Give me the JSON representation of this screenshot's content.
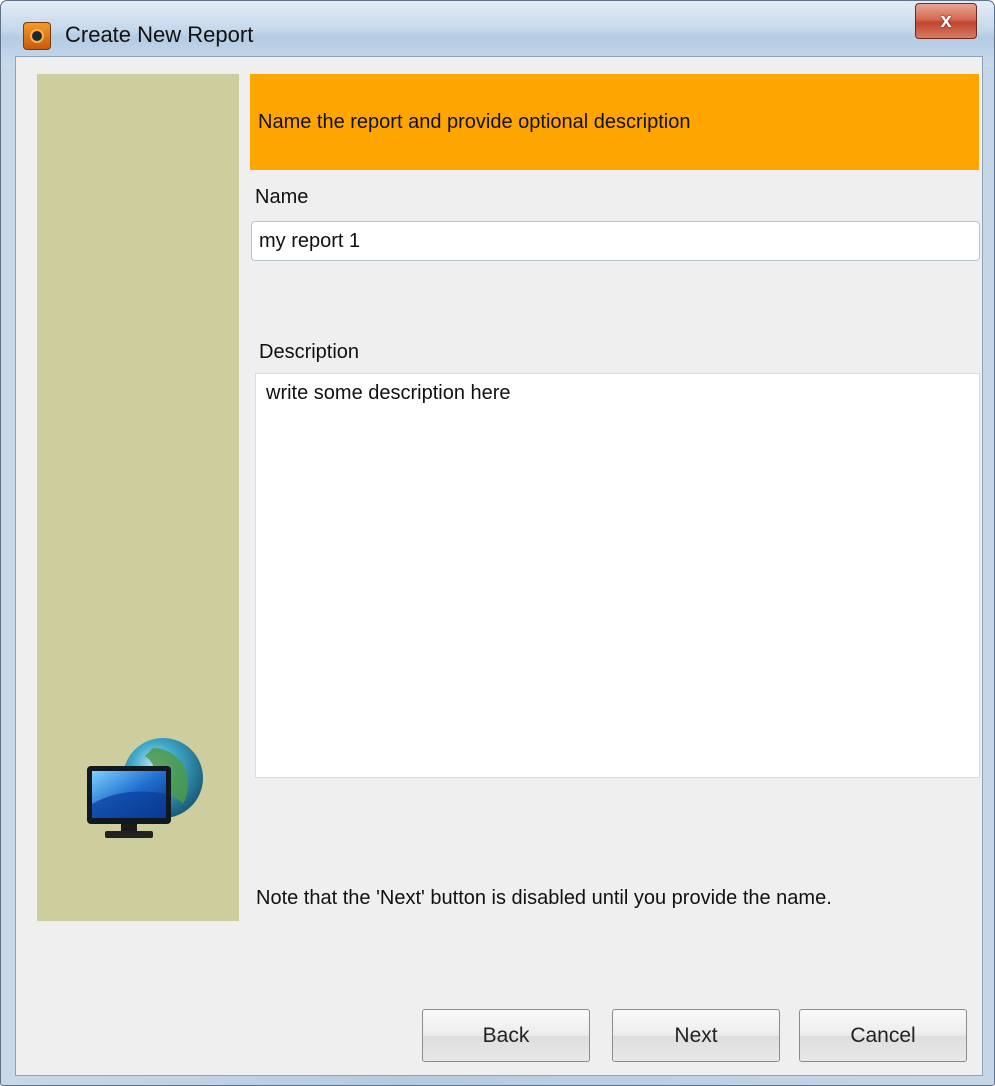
{
  "window": {
    "title": "Create New Report",
    "close_label": "x"
  },
  "icons": {
    "app": "report-app-icon",
    "close": "close-icon",
    "side": "monitor-globe-icon"
  },
  "header": {
    "instruction": "Name the report and provide optional description"
  },
  "form": {
    "name_label": "Name",
    "name_value": "my report 1",
    "description_label": "Description",
    "description_value": "write some description here"
  },
  "note": "Note that the 'Next' button is disabled until you provide the name.",
  "buttons": {
    "back": "Back",
    "next": "Next",
    "cancel": "Cancel"
  },
  "colors": {
    "header_band": "#ffa500",
    "side_panel": "#cdcd9e",
    "dialog_bg": "#efefef"
  }
}
